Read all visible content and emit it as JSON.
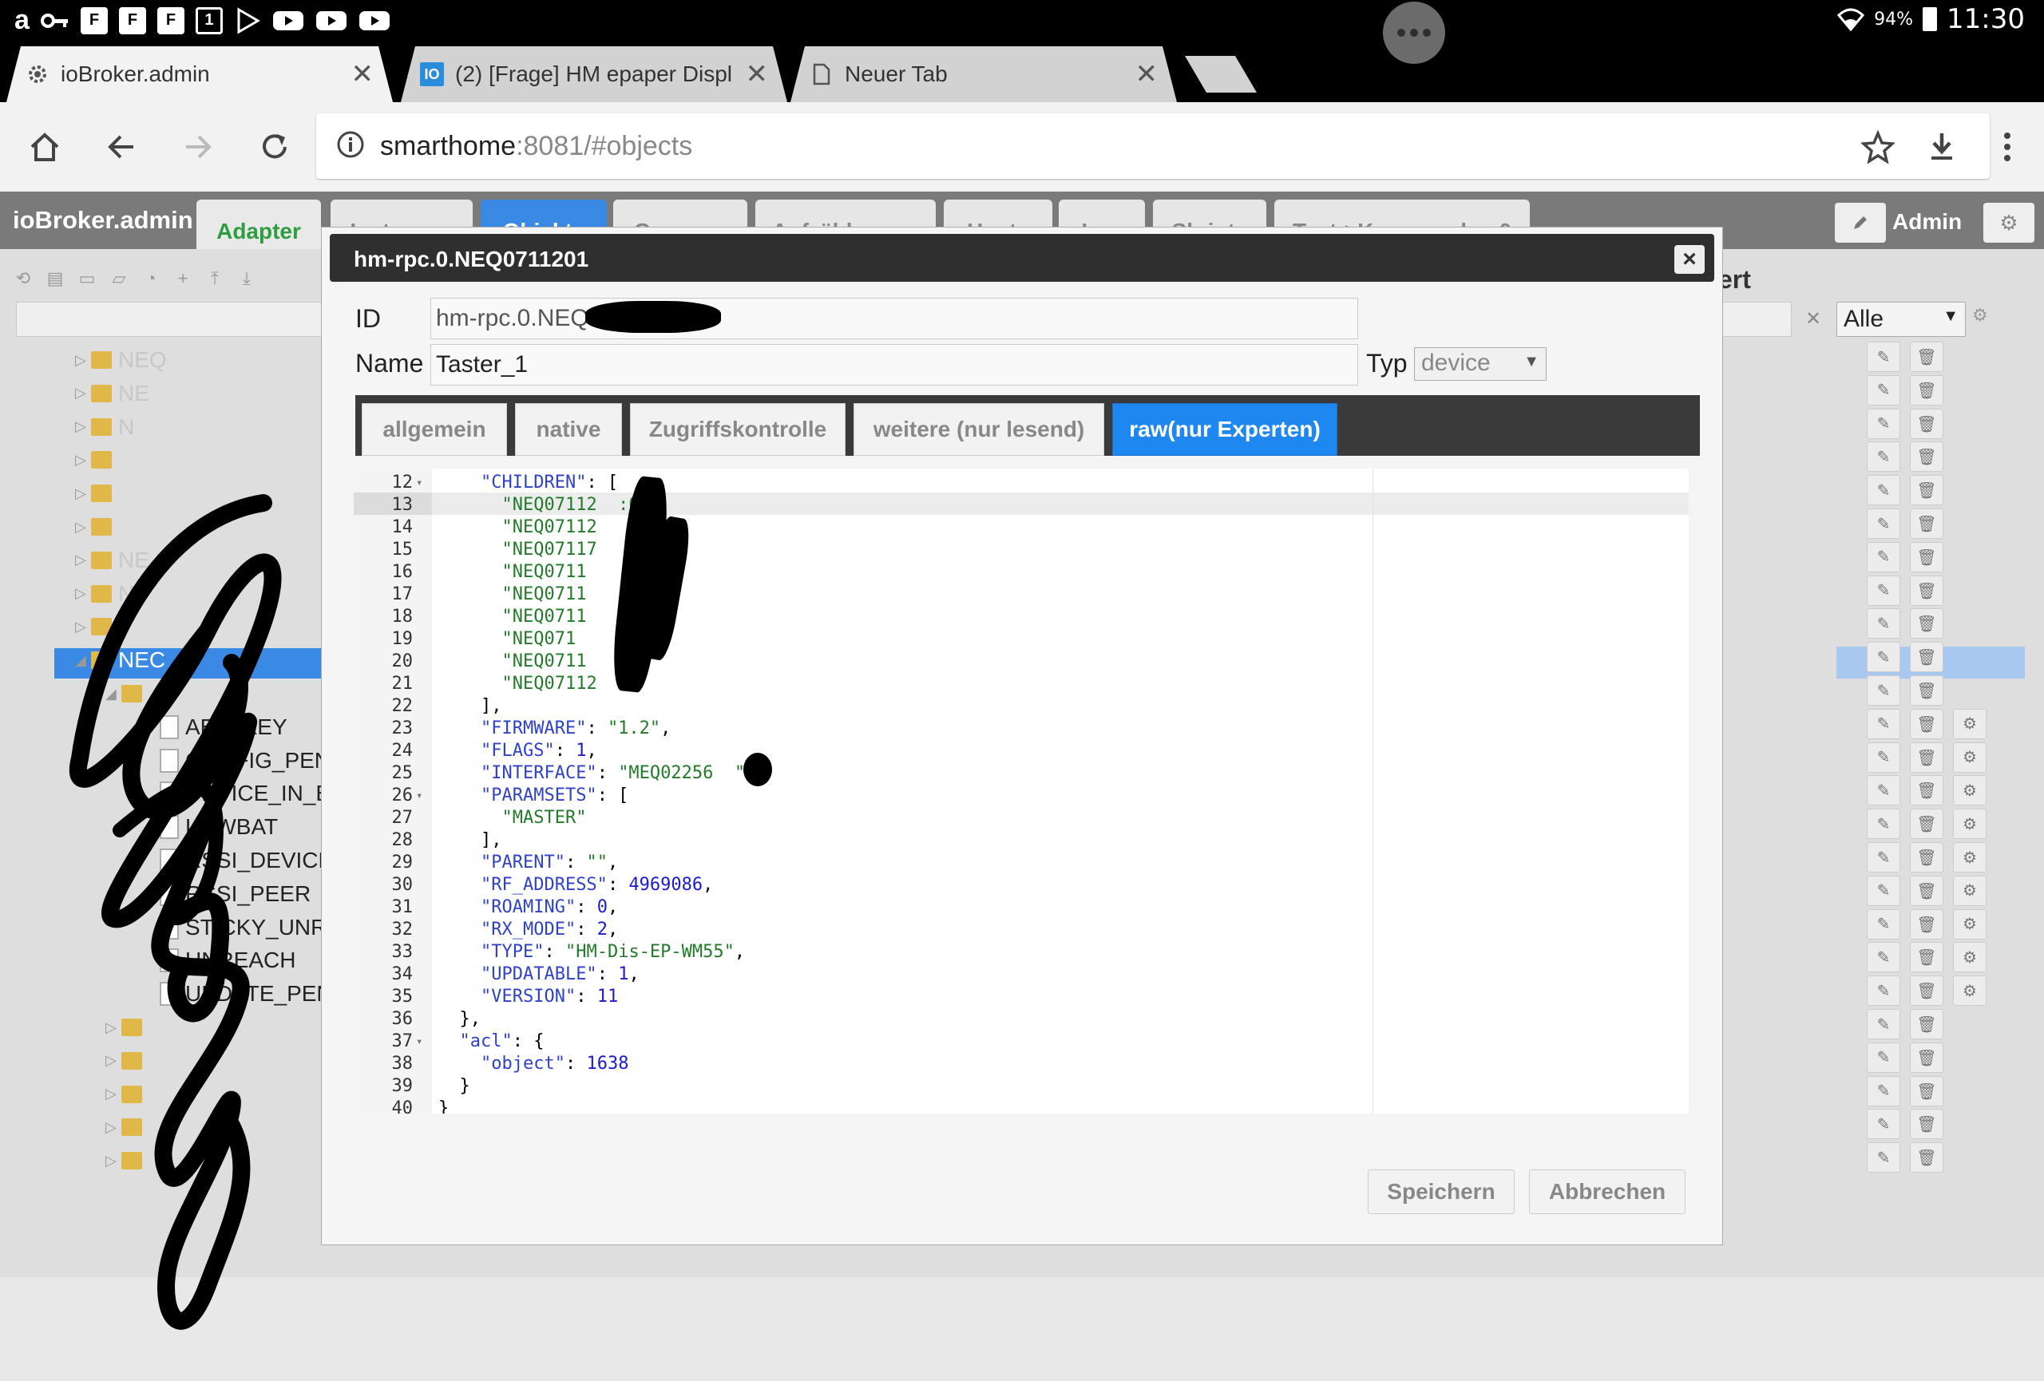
{
  "statusbar": {
    "battery": "94%",
    "time": "11:30",
    "icons": [
      "amazon-icon",
      "key-icon",
      "f-icon",
      "f-icon",
      "f-icon",
      "calendar-icon",
      "play-store-icon",
      "youtube-icon",
      "youtube-icon",
      "youtube-icon",
      "wifi-icon",
      "battery-icon"
    ]
  },
  "browser": {
    "tabs": [
      {
        "title": "ioBroker.admin",
        "icon": "gear-icon",
        "active": true
      },
      {
        "title": "(2) [Frage] HM epaper Displ",
        "icon": "iobroker-forum-icon",
        "active": false
      },
      {
        "title": "Neuer Tab",
        "icon": "page-icon",
        "active": false
      }
    ],
    "close_glyph": "✕",
    "url_host": "smarthome",
    "url_rest": ":8081/#objects"
  },
  "app": {
    "title": "ioBroker.admin",
    "tabs": [
      "Adapter",
      "Instanzen",
      "Objekte",
      "Gruppen",
      "Aufzählungen",
      "Hosts",
      "Log",
      "Skripte",
      "Text->Kommandos.0"
    ],
    "user": "Admin",
    "column_header": "ert",
    "filter_select": "Alle"
  },
  "tree": {
    "rows": [
      {
        "label": "NEQ",
        "type": "folder",
        "level": 1
      },
      {
        "label": "NE",
        "type": "folder",
        "level": 1
      },
      {
        "label": "N",
        "type": "folder",
        "level": 1
      },
      {
        "label": "",
        "type": "folder",
        "level": 1
      },
      {
        "label": "",
        "type": "folder",
        "level": 1
      },
      {
        "label": "",
        "type": "folder",
        "level": 1
      },
      {
        "label": "NE 2",
        "type": "folder",
        "level": 1
      },
      {
        "label": "N",
        "type": "folder",
        "level": 1
      },
      {
        "label": "",
        "type": "folder",
        "level": 1
      },
      {
        "label": "NEC",
        "type": "folder",
        "level": 1,
        "selected": true
      },
      {
        "label": "",
        "type": "folder",
        "level": 2
      },
      {
        "label": "AES_KEY",
        "type": "file",
        "level": 3
      },
      {
        "label": "CONFIG_PEN",
        "type": "file",
        "level": 3
      },
      {
        "label": "DEVICE_IN_E",
        "type": "file",
        "level": 3
      },
      {
        "label": "LOWBAT",
        "type": "file",
        "level": 3
      },
      {
        "label": "RSSI_DEVICE",
        "type": "file",
        "level": 3
      },
      {
        "label": "RSSI_PEER",
        "type": "file",
        "level": 3
      },
      {
        "label": "STICKY_UNR",
        "type": "file",
        "level": 3
      },
      {
        "label": "UNREACH",
        "type": "file",
        "level": 3
      },
      {
        "label": "UPDATE_PEN",
        "type": "file",
        "level": 3
      },
      {
        "label": "",
        "type": "folder",
        "level": 2
      },
      {
        "label": "",
        "type": "folder",
        "level": 2
      },
      {
        "label": "",
        "type": "folder",
        "level": 2
      },
      {
        "label": "",
        "type": "folder",
        "level": 2
      },
      {
        "label": "",
        "type": "folder",
        "level": 2
      }
    ]
  },
  "dialog": {
    "title": "hm-rpc.0.NEQ0711201",
    "id_label": "ID",
    "id_value": "hm-rpc.0.NEQ",
    "name_label": "Name",
    "name_value": "Taster_1",
    "type_label": "Typ",
    "type_value": "device",
    "tabs": [
      "allgemein",
      "native",
      "Zugriffskontrolle",
      "weitere (nur lesend)",
      "raw(nur Experten)"
    ],
    "active_tab": "raw(nur Experten)",
    "save_label": "Speichern",
    "cancel_label": "Abbrechen",
    "close_glyph": "×"
  },
  "editor": {
    "current_line": 13,
    "lines": [
      {
        "n": 12,
        "fold": true,
        "indent": 4,
        "parts": [
          [
            "k",
            "\"CHILDREN\""
          ],
          [
            "p",
            ": ["
          ]
        ]
      },
      {
        "n": 13,
        "indent": 6,
        "parts": [
          [
            "s",
            "\"NEQ07112  :0\""
          ],
          [
            "p",
            ","
          ]
        ]
      },
      {
        "n": 14,
        "indent": 6,
        "parts": [
          [
            "s",
            "\"NEQ07112   \""
          ],
          [
            "p",
            ","
          ]
        ]
      },
      {
        "n": 15,
        "indent": 6,
        "parts": [
          [
            "s",
            "\"NEQ07117   \""
          ],
          [
            "p",
            ","
          ]
        ]
      },
      {
        "n": 16,
        "indent": 6,
        "parts": [
          [
            "s",
            "\"NEQ0711    \""
          ],
          [
            "p",
            ","
          ]
        ]
      },
      {
        "n": 17,
        "indent": 6,
        "parts": [
          [
            "s",
            "\"NEQ0711    \""
          ],
          [
            "p",
            ","
          ]
        ]
      },
      {
        "n": 18,
        "indent": 6,
        "parts": [
          [
            "s",
            "\"NEQ0711   5\""
          ],
          [
            "p",
            ","
          ]
        ]
      },
      {
        "n": 19,
        "indent": 6,
        "parts": [
          [
            "s",
            "\"NEQ071    6\""
          ],
          [
            "p",
            ","
          ]
        ]
      },
      {
        "n": 20,
        "indent": 6,
        "parts": [
          [
            "s",
            "\"NEQ0711   7\""
          ],
          [
            "p",
            ","
          ]
        ]
      },
      {
        "n": 21,
        "indent": 6,
        "parts": [
          [
            "s",
            "\"NEQ07112  8\""
          ]
        ]
      },
      {
        "n": 22,
        "indent": 4,
        "parts": [
          [
            "p",
            "],"
          ]
        ]
      },
      {
        "n": 23,
        "indent": 4,
        "parts": [
          [
            "k",
            "\"FIRMWARE\""
          ],
          [
            "p",
            ": "
          ],
          [
            "s",
            "\"1.2\""
          ],
          [
            "p",
            ","
          ]
        ]
      },
      {
        "n": 24,
        "indent": 4,
        "parts": [
          [
            "k",
            "\"FLAGS\""
          ],
          [
            "p",
            ": "
          ],
          [
            "n",
            "1"
          ],
          [
            "p",
            ","
          ]
        ]
      },
      {
        "n": 25,
        "indent": 4,
        "parts": [
          [
            "k",
            "\"INTERFACE\""
          ],
          [
            "p",
            ": "
          ],
          [
            "s",
            "\"MEQ02256  \""
          ],
          [
            "p",
            ","
          ]
        ]
      },
      {
        "n": 26,
        "fold": true,
        "indent": 4,
        "parts": [
          [
            "k",
            "\"PARAMSETS\""
          ],
          [
            "p",
            ": ["
          ]
        ]
      },
      {
        "n": 27,
        "indent": 6,
        "parts": [
          [
            "s",
            "\"MASTER\""
          ]
        ]
      },
      {
        "n": 28,
        "indent": 4,
        "parts": [
          [
            "p",
            "],"
          ]
        ]
      },
      {
        "n": 29,
        "indent": 4,
        "parts": [
          [
            "k",
            "\"PARENT\""
          ],
          [
            "p",
            ": "
          ],
          [
            "s",
            "\"\""
          ],
          [
            "p",
            ","
          ]
        ]
      },
      {
        "n": 30,
        "indent": 4,
        "parts": [
          [
            "k",
            "\"RF_ADDRESS\""
          ],
          [
            "p",
            ": "
          ],
          [
            "n",
            "4969086"
          ],
          [
            "p",
            ","
          ]
        ]
      },
      {
        "n": 31,
        "indent": 4,
        "parts": [
          [
            "k",
            "\"ROAMING\""
          ],
          [
            "p",
            ": "
          ],
          [
            "n",
            "0"
          ],
          [
            "p",
            ","
          ]
        ]
      },
      {
        "n": 32,
        "indent": 4,
        "parts": [
          [
            "k",
            "\"RX_MODE\""
          ],
          [
            "p",
            ": "
          ],
          [
            "n",
            "2"
          ],
          [
            "p",
            ","
          ]
        ]
      },
      {
        "n": 33,
        "indent": 4,
        "parts": [
          [
            "k",
            "\"TYPE\""
          ],
          [
            "p",
            ": "
          ],
          [
            "s",
            "\"HM-Dis-EP-WM55\""
          ],
          [
            "p",
            ","
          ]
        ]
      },
      {
        "n": 34,
        "indent": 4,
        "parts": [
          [
            "k",
            "\"UPDATABLE\""
          ],
          [
            "p",
            ": "
          ],
          [
            "n",
            "1"
          ],
          [
            "p",
            ","
          ]
        ]
      },
      {
        "n": 35,
        "indent": 4,
        "parts": [
          [
            "k",
            "\"VERSION\""
          ],
          [
            "p",
            ": "
          ],
          [
            "n",
            "11"
          ]
        ]
      },
      {
        "n": 36,
        "indent": 2,
        "parts": [
          [
            "p",
            "},"
          ]
        ]
      },
      {
        "n": 37,
        "fold": true,
        "indent": 2,
        "parts": [
          [
            "k",
            "\"acl\""
          ],
          [
            "p",
            ": {"
          ]
        ]
      },
      {
        "n": 38,
        "indent": 4,
        "parts": [
          [
            "k",
            "\"object\""
          ],
          [
            "p",
            ": "
          ],
          [
            "n",
            "1638"
          ]
        ]
      },
      {
        "n": 39,
        "indent": 2,
        "parts": [
          [
            "p",
            "}"
          ]
        ]
      },
      {
        "n": 40,
        "indent": 0,
        "parts": [
          [
            "p",
            "}"
          ]
        ]
      }
    ]
  }
}
